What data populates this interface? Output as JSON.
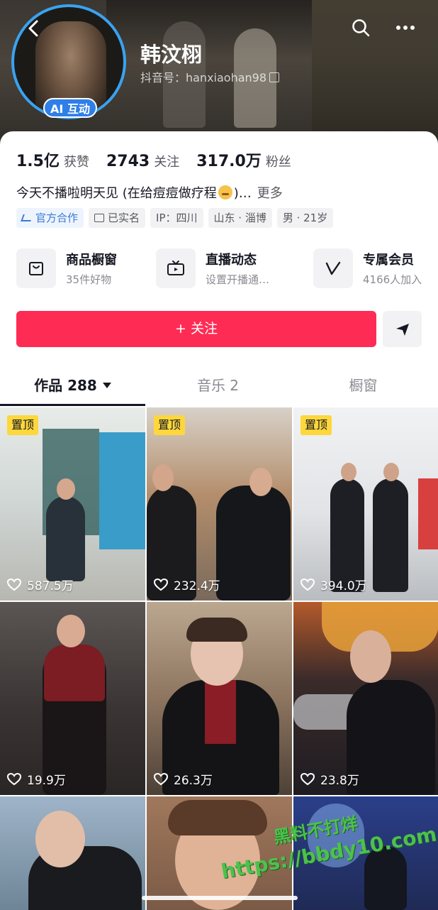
{
  "profile": {
    "name": "韩汶栩",
    "douyin_id": "抖音号：hanxiaohan98",
    "ai_badge": "AI 互动"
  },
  "stats": {
    "likes_value": "1.5亿",
    "likes_label": "获赞",
    "following_value": "2743",
    "following_label": "关注",
    "followers_value": "317.0万",
    "followers_label": "粉丝"
  },
  "bio": {
    "text_start": "今天不播啦明天见 (在给痘痘做疗程",
    "text_end": ")…",
    "more": "更多"
  },
  "tags": [
    "官方合作",
    "已实名",
    "IP：四川",
    "山东 · 淄博",
    "男 · 21岁"
  ],
  "features": [
    {
      "title": "商品橱窗",
      "sub": "35件好物",
      "icon": "bag-icon"
    },
    {
      "title": "直播动态",
      "sub": "设置开播通…",
      "icon": "tv-icon"
    },
    {
      "title": "专属会员",
      "sub": "4166人加入",
      "icon": "v-icon"
    }
  ],
  "actions": {
    "follow": "+ 关注"
  },
  "tabs": [
    {
      "label": "作品 288",
      "active": true
    },
    {
      "label": "音乐 2",
      "active": false
    },
    {
      "label": "橱窗",
      "active": false
    }
  ],
  "videos": [
    {
      "pinned": "置顶",
      "likes": "587.5万"
    },
    {
      "pinned": "置顶",
      "likes": "232.4万"
    },
    {
      "pinned": "置顶",
      "likes": "394.0万"
    },
    {
      "pinned": "",
      "likes": "19.9万"
    },
    {
      "pinned": "",
      "likes": "26.3万"
    },
    {
      "pinned": "",
      "likes": "23.8万"
    },
    {
      "pinned": "",
      "likes": ""
    },
    {
      "pinned": "",
      "likes": ""
    },
    {
      "pinned": "",
      "likes": ""
    }
  ],
  "watermark": {
    "line1": "黑料不打烊",
    "line2": "https://bbdy10.com"
  },
  "colors": {
    "accent": "#fe2c55",
    "pin_badge": "#fdd73b",
    "ai_badge": "#2f7fe8"
  }
}
